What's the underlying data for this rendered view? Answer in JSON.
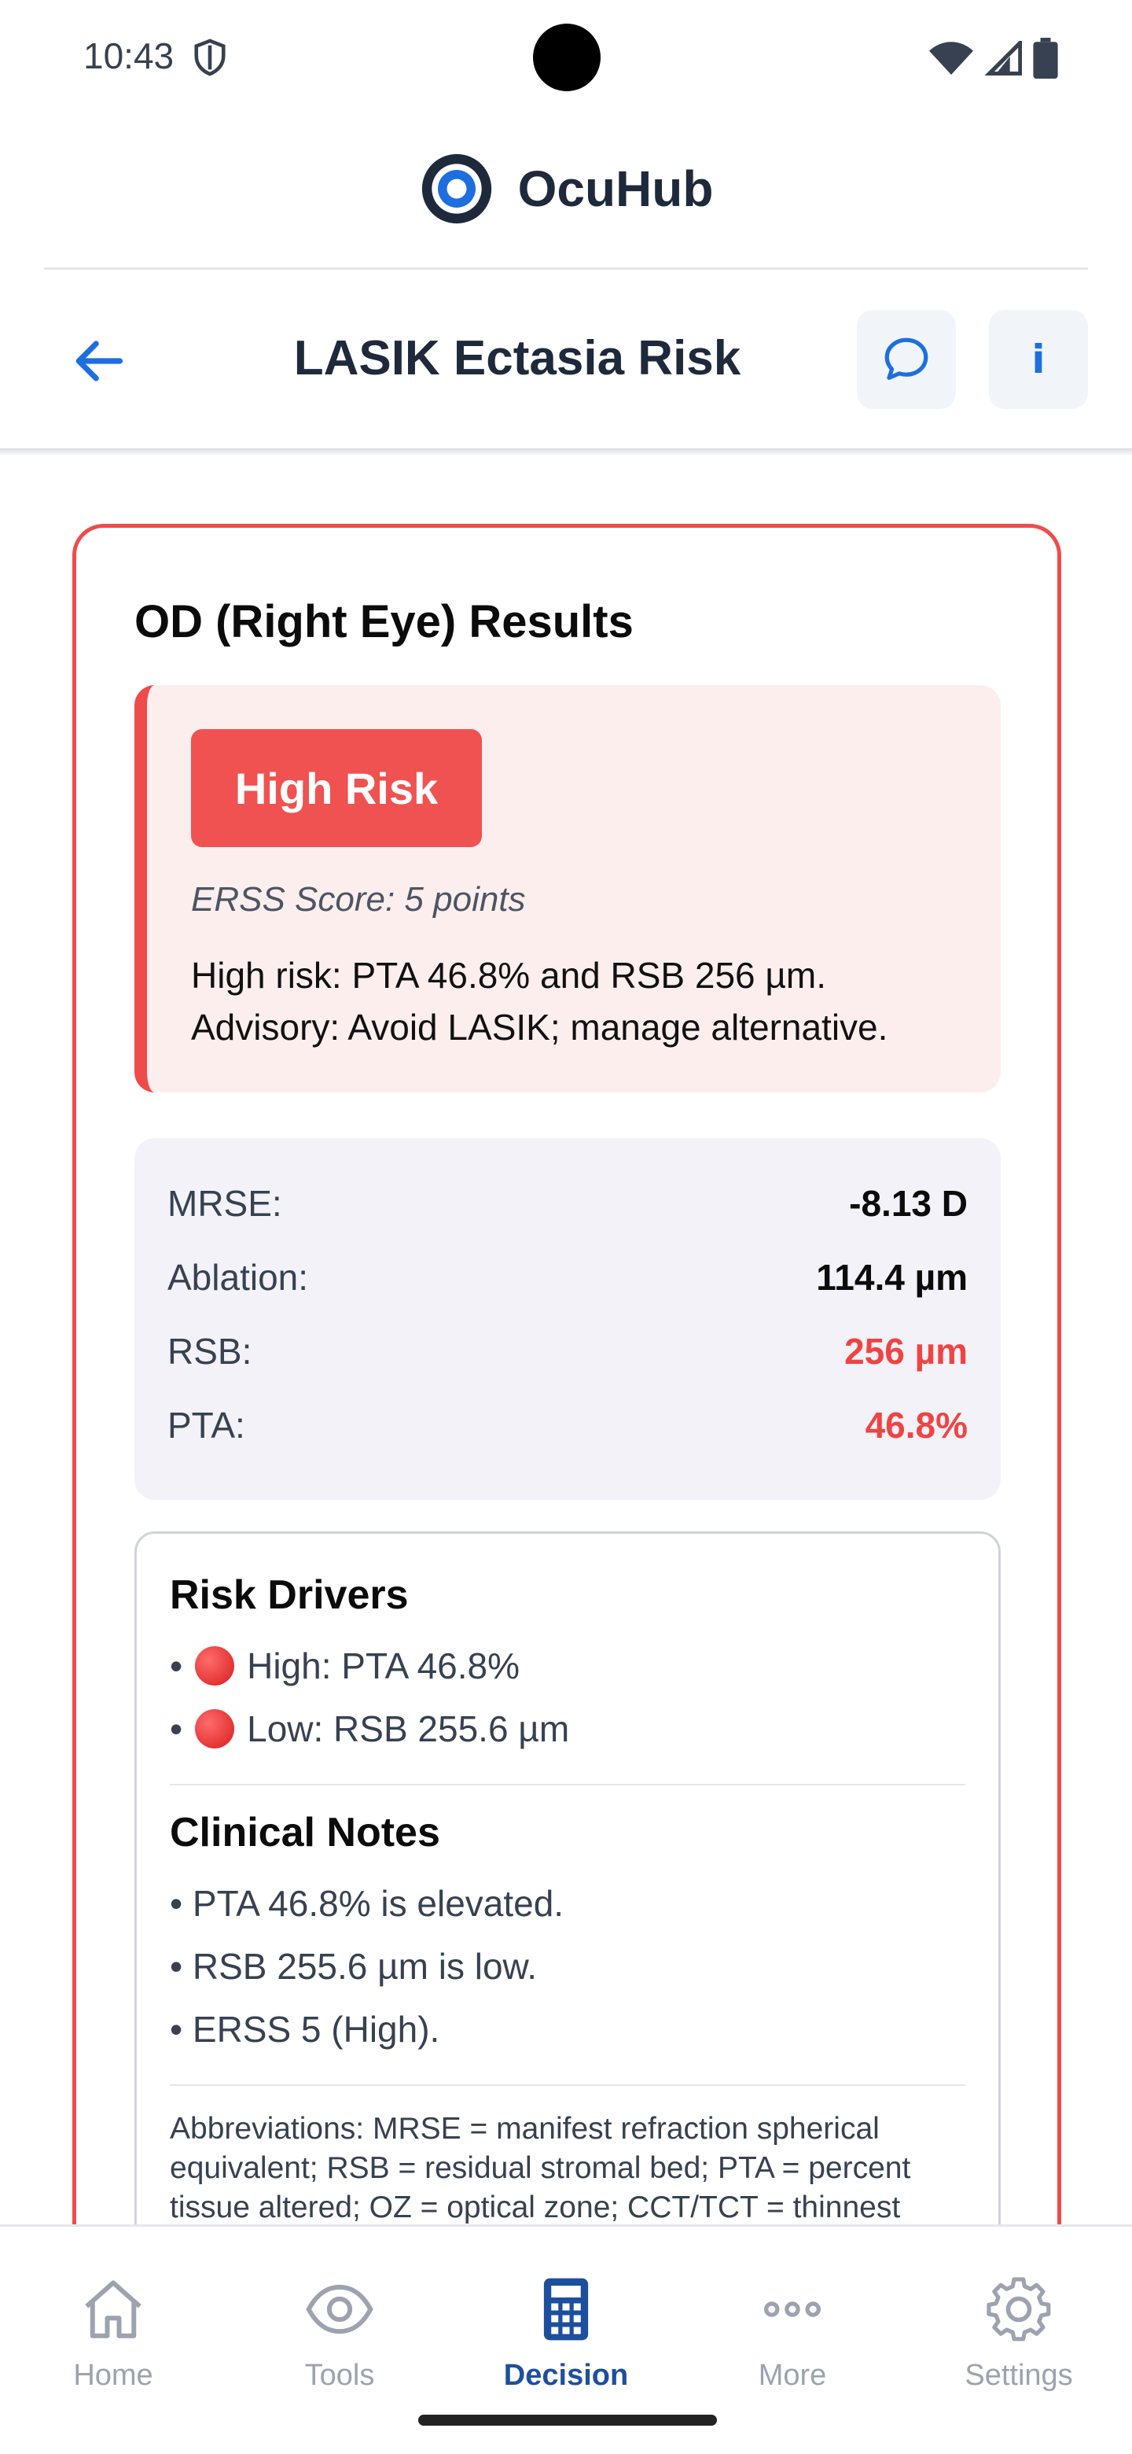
{
  "status_bar": {
    "time": "10:43"
  },
  "app": {
    "title": "OcuHub"
  },
  "toolbar": {
    "page_title": "LASIK Ectasia Risk",
    "info_label": "i"
  },
  "result": {
    "title": "OD (Right Eye) Results",
    "risk_badge": "High Risk",
    "erss_score": "ERSS Score: 5 points",
    "risk_description_line1": "High risk: PTA 46.8% and RSB 256 µm.",
    "risk_description_line2": "Advisory: Avoid LASIK; manage alternative."
  },
  "metrics": [
    {
      "label": "MRSE:",
      "value": "-8.13 D",
      "alert": false
    },
    {
      "label": "Ablation:",
      "value": "114.4 µm",
      "alert": false
    },
    {
      "label": "RSB:",
      "value": "256 µm",
      "alert": true
    },
    {
      "label": "PTA:",
      "value": "46.8%",
      "alert": true
    }
  ],
  "risk_drivers": {
    "heading": "Risk Drivers",
    "items": [
      "High: PTA 46.8%",
      "Low: RSB 255.6 µm"
    ]
  },
  "clinical_notes": {
    "heading": "Clinical Notes",
    "items": [
      "• PTA 46.8% is elevated.",
      "• RSB 255.6 µm is low.",
      "• ERSS 5 (High)."
    ]
  },
  "abbreviations": "Abbreviations: MRSE = manifest refraction spherical equivalent; RSB = residual stromal bed; PTA = percent tissue altered; OZ = optical zone; CCT/TCT = thinnest",
  "nav": [
    {
      "label": "Home",
      "active": false
    },
    {
      "label": "Tools",
      "active": false
    },
    {
      "label": "Decision",
      "active": true
    },
    {
      "label": "More",
      "active": false
    },
    {
      "label": "Settings",
      "active": false
    }
  ],
  "colors": {
    "accent": "#1d6fe0",
    "danger": "#ef4444",
    "nav_active": "#1d4f9e"
  }
}
